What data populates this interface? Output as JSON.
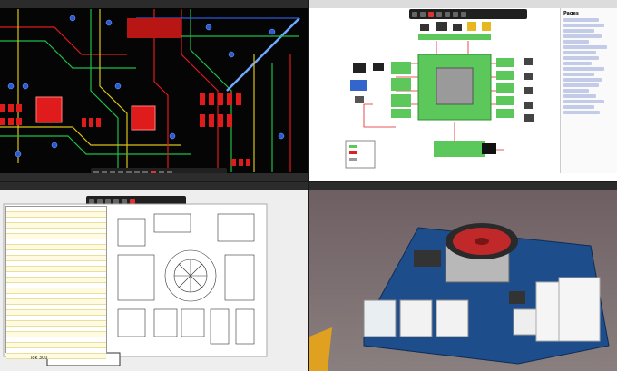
{
  "panes": {
    "pcb_layout": {
      "toolbar_icons": [
        "select-icon",
        "route-icon",
        "via-icon",
        "zoom-icon",
        "layers-icon",
        "measure-icon",
        "grid-icon",
        "settings-icon",
        "save-icon",
        "undo-icon"
      ]
    },
    "block_diagram": {
      "side_panel_title": "Pages"
    },
    "schematic": {
      "zoom_label": "lok 300"
    },
    "board_3d": {}
  },
  "colors": {
    "pcb_background": "#050505",
    "trace_red": "#e01b1b",
    "trace_green": "#1fbf4a",
    "trace_yellow": "#d8c21a",
    "trace_blue": "#2a5ad8",
    "block_green": "#5cc85c",
    "board_blue": "#1e4d8c",
    "fan_red": "#c0282a",
    "viewport_bg": "#7b6d6f"
  }
}
